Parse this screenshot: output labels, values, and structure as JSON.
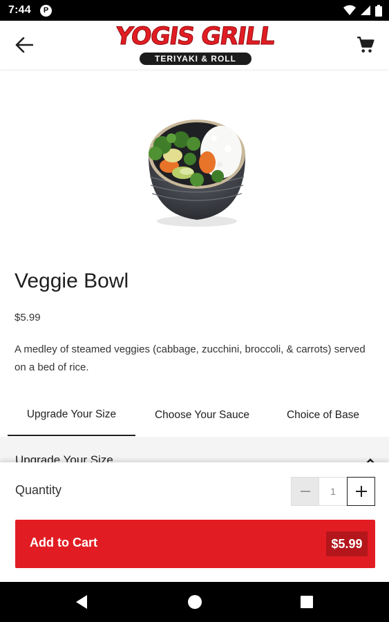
{
  "status_bar": {
    "time": "7:44",
    "notification_badge": "P",
    "icons": [
      "wifi-icon",
      "signal-icon",
      "battery-icon"
    ]
  },
  "header": {
    "logo_title": "YOGIS GRILL",
    "logo_subtitle": "TERIYAKI & ROLL",
    "icons": {
      "back": "arrow-back-icon",
      "cart": "shopping-cart-icon"
    }
  },
  "product": {
    "name": "Veggie Bowl",
    "price": "$5.99",
    "description": "A medley of steamed veggies (cabbage, zucchini, broccoli, & carrots) served on a bed of rice."
  },
  "tabs": [
    {
      "label": "Upgrade Your Size",
      "active": true
    },
    {
      "label": "Choose Your Sauce",
      "active": false
    },
    {
      "label": "Choice of Base",
      "active": false
    }
  ],
  "section": {
    "title": "Upgrade Your Size",
    "icon": "chevron-up-icon"
  },
  "cart_panel": {
    "quantity_label": "Quantity",
    "quantity_value": "1",
    "add_to_cart_label": "Add to Cart",
    "add_to_cart_price": "$5.99"
  },
  "nav_bar": {
    "icons": [
      "nav-back-icon",
      "nav-home-icon",
      "nav-recents-icon"
    ]
  },
  "colors": {
    "brand_red": "#e11d23",
    "price_badge": "#b3161b",
    "text_dark": "#1e1e1e"
  }
}
